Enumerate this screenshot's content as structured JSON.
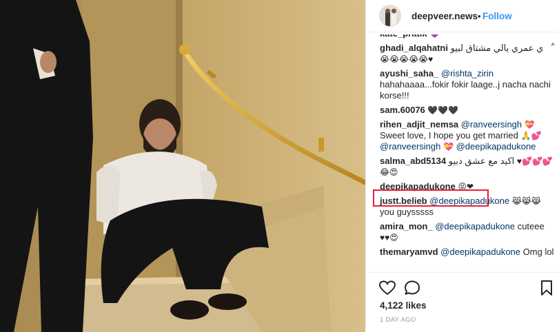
{
  "post": {
    "username": "deepveer.news",
    "separator": "•",
    "follow_label": "Follow",
    "likes": "4,122 likes",
    "time_ago": "1 DAY AGO"
  },
  "comments": [
    {
      "user": "kate_pratik",
      "text": "",
      "emoji": "💜"
    },
    {
      "user": "ghadi_alqahatni",
      "text": "ي عمري يالي مشتاق لبيو",
      "emoji": "😭😭😭😭😭♥"
    },
    {
      "user": "ayushi_saha_",
      "mention": "@rishta_zirin",
      "text": "hahahaaaa...fokir fokir laage..j nacha nachi korse!!!"
    },
    {
      "user": "sam.60076",
      "text": "",
      "emoji": "🖤🖤🖤"
    },
    {
      "user": "rihen_adjit_nemsa",
      "mention": "@ranveersingh",
      "emoji1": "💝",
      "text": "Sweet love, I hope you get married",
      "emoji2": "🙏💕",
      "mention2": "@ranveersingh",
      "emoji3": "💝",
      "mention3": "@deepikapadukone"
    },
    {
      "user": "salma_abd5134",
      "text": "اكيد مع عشق دبيو",
      "emoji": "♥💕💕💕😂😍"
    },
    {
      "user": "deepikapadukone",
      "text": "",
      "emoji": "😝❤"
    },
    {
      "user": "justt.belieb",
      "mention": "@deepikapadukone",
      "emoji": "😹😹😹",
      "text": "you guysssss"
    },
    {
      "user": "amira_mon_",
      "mention": "@deepikapadukone",
      "text": "cuteee",
      "emoji": "♥♥😍"
    },
    {
      "user": "themaryamvd",
      "mention": "@deepikapadukone",
      "text": "Omg lol"
    }
  ],
  "colors": {
    "link": "#3897f0",
    "mention": "#003569",
    "highlight_border": "#e3213d",
    "photo_wall": "#b8995c"
  },
  "icons": {
    "like": "heart-outline-icon",
    "comment": "speech-bubble-icon",
    "save": "bookmark-icon"
  }
}
